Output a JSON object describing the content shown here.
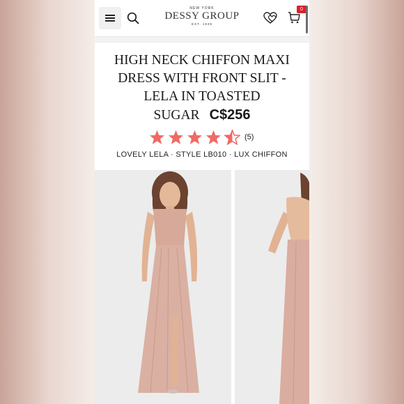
{
  "header": {
    "logo_top": "NEW YORK",
    "logo_main": "DESSY GROUP",
    "logo_est": "EST. 1939",
    "cart_count": "0",
    "icons": [
      "menu-icon",
      "search-icon",
      "heart-icon",
      "cart-icon"
    ]
  },
  "product": {
    "title_line1": "HIGH NECK CHIFFON MAXI",
    "title_line2": "DRESS WITH FRONT SLIT -",
    "title_line3": "LELA IN TOASTED",
    "title_line4": "SUGAR",
    "price": "C$256",
    "rating_value": 4.5,
    "rating_max": 5,
    "review_count": "(5)",
    "subline": "LOVELY LELA · STYLE LB010 · LUX CHIFFON"
  },
  "colors": {
    "star": "#ef6a65",
    "badge": "#d8232a",
    "dress": "#d9aea0"
  }
}
